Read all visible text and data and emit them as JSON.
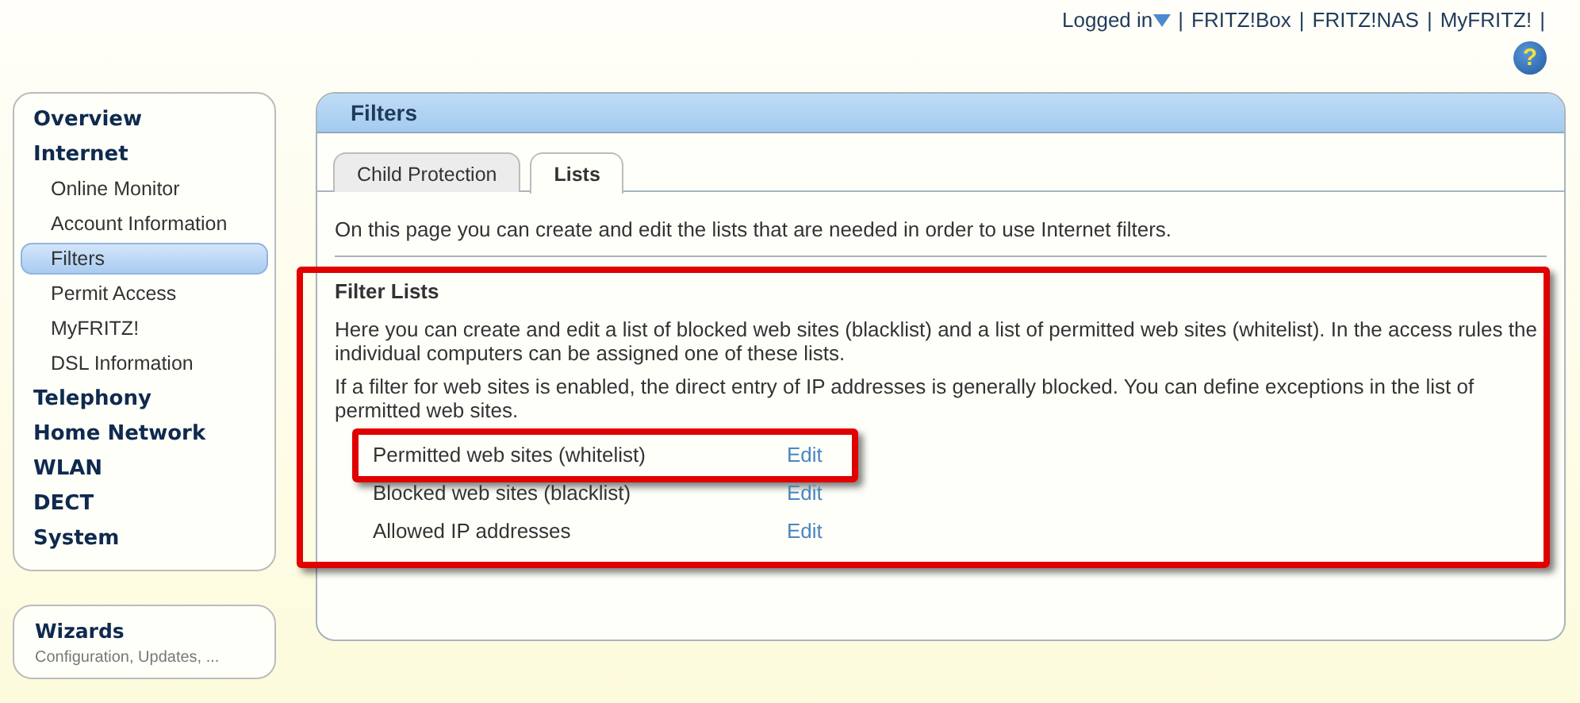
{
  "header": {
    "login": {
      "label": "Logged in",
      "expanded": false
    },
    "separator": "|",
    "links": [
      "FRITZ!Box",
      "FRITZ!NAS",
      "MyFRITZ!"
    ],
    "help": "?"
  },
  "sidebar": {
    "items": [
      {
        "label": "Overview",
        "selected": false
      },
      {
        "label": "Internet",
        "selected": false,
        "children": [
          {
            "label": "Online Monitor",
            "selected": false
          },
          {
            "label": "Account Information",
            "selected": false
          },
          {
            "label": "Filters",
            "selected": true
          },
          {
            "label": "Permit Access",
            "selected": false
          },
          {
            "label": "MyFRITZ!",
            "selected": false
          },
          {
            "label": "DSL Information",
            "selected": false
          }
        ]
      },
      {
        "label": "Telephony",
        "selected": false
      },
      {
        "label": "Home Network",
        "selected": false
      },
      {
        "label": "WLAN",
        "selected": false
      },
      {
        "label": "DECT",
        "selected": false
      },
      {
        "label": "System",
        "selected": false
      }
    ]
  },
  "wizards": {
    "title": "Wizards",
    "subtitle": "Configuration, Updates, ..."
  },
  "panel": {
    "title": "Filters",
    "tabs": [
      {
        "label": "Child Protection",
        "selected": false
      },
      {
        "label": "Lists",
        "selected": true
      }
    ],
    "intro": "On this page you can create and edit the lists that are needed in order to use Internet filters.",
    "section": {
      "title": "Filter Lists",
      "highlighted": true,
      "paragraphs": [
        "Here you can create and edit a list of blocked web sites (blacklist) and a list of permitted web sites (whitelist). In the access rules the individual computers can be assigned one of these lists.",
        "If a filter for web sites is enabled, the direct entry of IP addresses is generally blocked. You can define exceptions in the list of permitted web sites."
      ],
      "lists": [
        {
          "label": "Permitted web sites (whitelist)",
          "action": "Edit",
          "highlighted": true
        },
        {
          "label": "Blocked web sites (blacklist)",
          "action": "Edit",
          "highlighted": false
        },
        {
          "label": "Allowed IP addresses",
          "action": "Edit",
          "highlighted": false
        }
      ]
    }
  }
}
